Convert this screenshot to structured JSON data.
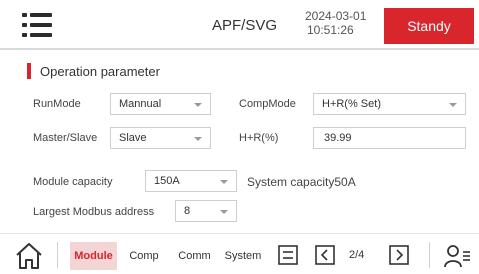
{
  "header": {
    "menu_icon": "menu-icon",
    "title": "APF/SVG",
    "date": "2024-03-01",
    "time": "10:51:26",
    "status_label": "Standy",
    "status_color": "#d9252c"
  },
  "section": {
    "title": "Operation parameter"
  },
  "form": {
    "run_mode": {
      "label": "RunMode",
      "value": "Mannual"
    },
    "comp_mode": {
      "label": "CompMode",
      "value": "H+R(% Set)"
    },
    "master_slave": {
      "label": "Master/Slave",
      "value": "Slave"
    },
    "hr_percent": {
      "label": "H+R(%)",
      "value": "39.99"
    },
    "module_capacity": {
      "label": "Module capacity",
      "value": "150A"
    },
    "system_capacity": {
      "label": "System capacity",
      "value": "50A"
    },
    "modbus_address": {
      "label": "Largest Modbus address",
      "value": "8"
    }
  },
  "footer": {
    "home_icon": "home-icon",
    "tabs": [
      {
        "label": "Module",
        "active": true
      },
      {
        "label": "Comp",
        "active": false
      },
      {
        "label": "Comm",
        "active": false
      },
      {
        "label": "System",
        "active": false
      }
    ],
    "save_icon": "save-icon",
    "prev_icon": "chevron-left-icon",
    "page_indicator": "2/4",
    "next_icon": "chevron-right-icon",
    "user_icon": "user-menu-icon",
    "accent_color": "#d9252c"
  }
}
